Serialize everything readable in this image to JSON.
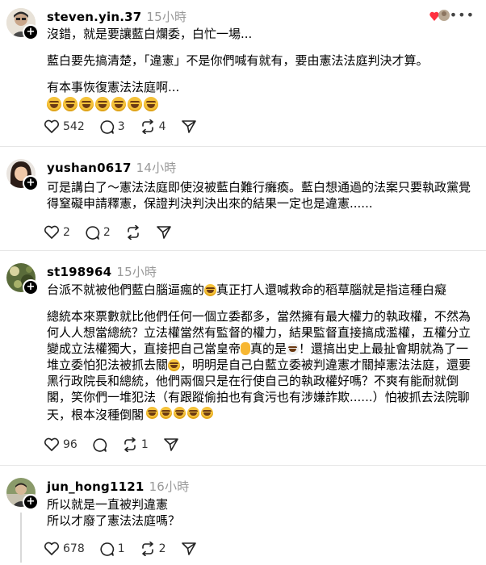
{
  "posts": [
    {
      "username": "steven.yin.37",
      "time": "15小時",
      "lines": [
        "沒錯，就是要讓藍白爛委，白忙一場..."
      ],
      "paragraph2": "藍白要先搞清楚，「違憲」不是你們喊有就有，要由憲法法庭判決才算。",
      "paragraph3": "有本事恢復憲法法庭啊...",
      "likes": "542",
      "comments": "3",
      "reposts": "4"
    },
    {
      "username": "yushan0617",
      "time": "14小時",
      "text": "可是講白了～憲法法庭即使沒被藍白難行癱瘓。藍白想通過的法案只要執政黨覺得窒礙申請釋憲，保證判決判決出來的結果一定也是違憲......",
      "likes": "2",
      "comments": "2"
    },
    {
      "username": "st198964",
      "time": "15小時",
      "line1a": "台派不就被他們藍白腦逼瘋的",
      "line1b": "真正打人還喊救命的稻草腦就是指這種白癡",
      "p2a": "總統本來票數就比他們任何一個立委都多，當然擁有最大權力的執政權，不然為何人人想當總統？立法權當然有監督的權力，結果監督直接搞成濫權，五權分立變成立法權獨大，直接把自己當皇帝",
      "p2b": "真的是",
      "p2c": "！還搞出史上最扯會期就為了一堆立委怕犯法被抓去關",
      "p2d": "，明明是自己白藍立委被判違憲才關掉憲法法庭，還要黑行政院長和總統，他們兩個只是在行使自己的執政權好嗎？不爽有能耐就倒閣，笑你們一堆犯法（有跟蹤偷拍也有貪污也有涉嫌詐欺......）怕被抓去法院聊天，根本沒種倒閣",
      "likes": "96",
      "reposts": "1"
    },
    {
      "username": "jun_hong1121",
      "time": "16小時",
      "line1": "所以就是一直被判違憲",
      "line2": "所以才廢了憲法法庭嗎？",
      "likes": "678",
      "comments": "1",
      "reposts": "2"
    }
  ],
  "colors": {
    "accent": "#000000",
    "muted": "#999999",
    "divider": "#e6e6e6",
    "like_red": "#ff3040"
  }
}
